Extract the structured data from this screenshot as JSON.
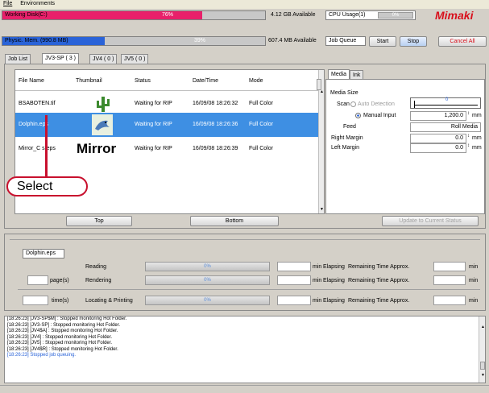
{
  "menu": {
    "file": "File",
    "environments": "Environments"
  },
  "status": {
    "working_disk_label": "Working Disk(C:)",
    "working_disk_percent_text": "76%",
    "working_disk_fill": 0.76,
    "working_disk_available": "4.12 GB Available",
    "cpu_label": "CPU Usage(1)",
    "cpu_percent_text": "0%",
    "memory_label": "Physic. Mem. (990.8 MB)",
    "memory_percent_text": "39%",
    "memory_fill": 0.39,
    "memory_available": "607.4 MB Available",
    "job_queue_label": "Job Queue",
    "start_label": "Start",
    "stop_label": "Stop",
    "cancel_all_label": "Cancel All",
    "logo": "Mimaki"
  },
  "tabs": [
    "Job List",
    "JV3-SP ( 3 )",
    "JV4 ( 0 )",
    "JV5 ( 0 )"
  ],
  "job_table": {
    "columns": [
      "File Name",
      "Thumbnail",
      "Status",
      "Date/Time",
      "Mode"
    ],
    "rows": [
      {
        "file": "BSABOTEN.tif",
        "status": "Waiting for RIP",
        "datetime": "16/09/08 18:26:32",
        "mode": "Full Color",
        "thumb": "cactus"
      },
      {
        "file": "Dolphin.eps",
        "status": "Waiting for RIP",
        "datetime": "16/09/08 18:26:36",
        "mode": "Full Color",
        "thumb": "dolphin"
      },
      {
        "file": "Mirror_C   s.eps",
        "status": "Waiting for RIP",
        "datetime": "16/09/08 18:26:39",
        "mode": "Full Color",
        "thumb": "Mirror"
      }
    ],
    "top_button": "Top",
    "bottom_button": "Bottom"
  },
  "callout": {
    "label": "Select"
  },
  "media_panel": {
    "tabs": [
      "Media",
      "Ink"
    ],
    "media_size_label": "Media Size",
    "scan_label": "Scan",
    "auto_detection_label": "Auto Detection",
    "scale_value": "0",
    "manual_input_label": "Manual Input",
    "manual_input_value": "1,200.0",
    "mm": "mm",
    "feed_label": "Feed",
    "feed_value": "Roll Media",
    "right_margin_label": "Right Margin",
    "right_margin_value": "0.0",
    "left_margin_label": "Left Margin",
    "left_margin_value": "0.0",
    "update_button": "Update to Current Status"
  },
  "progress": {
    "current_file": "Dolphin.eps",
    "reading_label": "Reading",
    "rendering_label": "Rendering",
    "locating_label": "Locating & Printing",
    "pages_label": "page(s)",
    "times_label": "time(s)",
    "percent": "0%",
    "min_label": "min",
    "elapsing_label": "Elapsing",
    "remaining_label": "Remaining Time Approx.",
    "min_suffix": "min"
  },
  "log": [
    "[18:26:23] [JV3-SP$M] : Stopped monitoring Hot Folder.",
    "[18:26:23] [JV3-SP] : Stopped monitoring Hot Folder.",
    "[18:26:23] [JV4$A] : Stopped monitoring Hot Folder.",
    "[18:26:23] [JV4] : Stopped monitoring Hot Folder.",
    "[18:26:23] [JV5] : Stopped monitoring Hot Folder.",
    "[18:26:23] [JV4$R] : Stopped monitoring Hot Folder.",
    "[18:26:23] Stopped job queuing."
  ],
  "colors": {
    "accent_pink": "#e8206a",
    "accent_blue": "#2a63d8",
    "selection": "#3e8fe3",
    "logo_red": "#d8101c",
    "callout_red": "#c8102e"
  }
}
